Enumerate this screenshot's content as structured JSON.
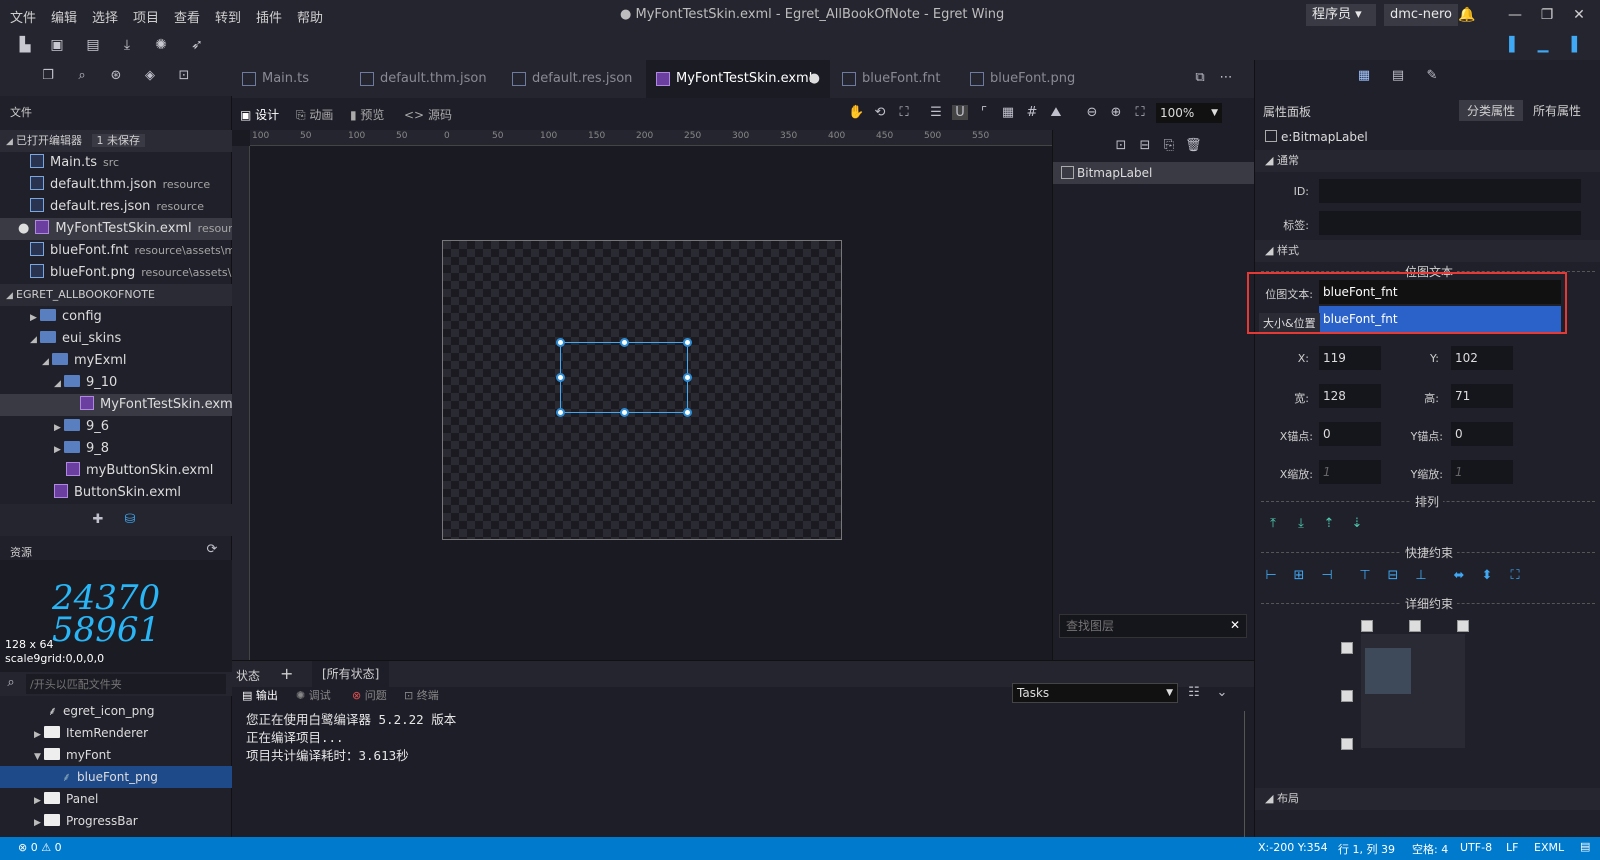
{
  "menu": [
    "文件",
    "编辑",
    "选择",
    "项目",
    "查看",
    "转到",
    "插件",
    "帮助"
  ],
  "window_title": "● MyFontTestSkin.exml - Egret_AllBookOfNote - Egret Wing",
  "role_select": "程序员",
  "user": "dmc-nero",
  "left": {
    "header": "文件",
    "open_editors_label": "已打开编辑器",
    "unsaved_badge": "1 未保存",
    "open_editors": [
      {
        "name": "Main.ts",
        "path": "src"
      },
      {
        "name": "default.thm.json",
        "path": "resource"
      },
      {
        "name": "default.res.json",
        "path": "resource"
      },
      {
        "name": "MyFontTestSkin.exml",
        "path": "resourc..."
      },
      {
        "name": "blueFont.fnt",
        "path": "resource\\assets\\m..."
      },
      {
        "name": "blueFont.png",
        "path": "resource\\assets\\..."
      }
    ],
    "project_label": "EGRET_ALLBOOKOFNOTE",
    "tree": [
      "config",
      "eui_skins",
      "myExml",
      "9_10",
      "MyFontTestSkin.exml",
      "9_6",
      "9_8",
      "myButtonSkin.exml",
      "ButtonSkin.exml"
    ],
    "resources_label": "资源",
    "preview_digits_1": "24370",
    "preview_digits_2": "58961",
    "preview_size": "128 x 64",
    "preview_scale9": "scale9grid:0,0,0,0",
    "search_placeholder": "/开头以匹配文件夹",
    "res_tree": [
      "egret_icon_png",
      "ItemRenderer",
      "myFont",
      "blueFont_png",
      "Panel",
      "ProgressBar"
    ]
  },
  "tabs": [
    "Main.ts",
    "default.thm.json",
    "default.res.json",
    "MyFontTestSkin.exml",
    "blueFont.fnt",
    "blueFont.png"
  ],
  "view_modes": [
    "设计",
    "动画",
    "预览",
    "源码"
  ],
  "zoom": "100%",
  "ruler_ticks": [
    "100",
    "50",
    "100",
    "50",
    "0",
    "50",
    "100",
    "150",
    "200",
    "250",
    "300",
    "350",
    "400",
    "450",
    "500",
    "550"
  ],
  "layers": {
    "item": "BitmapLabel",
    "search_placeholder": "查找图层"
  },
  "bottom": {
    "state_label": "状态",
    "all_states": "[所有状态]",
    "tabs": [
      "输出",
      "调试",
      "问题",
      "终端"
    ],
    "tasks": "Tasks",
    "output": [
      "您正在使用白鹭编译器 5.2.22 版本",
      "正在编译项目...",
      "项目共计编译耗时：3.613秒"
    ]
  },
  "props": {
    "title": "属性面板",
    "category_btn": "分类属性",
    "all_btn": "所有属性",
    "component": "e:BitmapLabel",
    "sect_common": "通常",
    "id_label": "ID:",
    "tag_label": "标签:",
    "sect_style": "样式",
    "bitmap_text_title": "位图文本",
    "bitmap_text_label": "位图文本:",
    "bitmap_text_value": "blueFont_fnt",
    "dropdown_option": "blueFont_fnt",
    "size_pos": "大小&位置",
    "x_label": "X:",
    "x": "119",
    "y_label": "Y:",
    "y": "102",
    "w_label": "宽:",
    "w": "128",
    "h_label": "高:",
    "h": "71",
    "ax_label": "X锚点:",
    "ax": "0",
    "ay_label": "Y锚点:",
    "ay": "0",
    "sx_label": "X缩放:",
    "sx": "1",
    "sy_label": "Y缩放:",
    "sy": "1",
    "arrange": "排列",
    "quick_constraint": "快捷约束",
    "detail_constraint": "详细约束",
    "layout": "布局"
  },
  "status": {
    "errors": "0",
    "warnings": "0",
    "cursor": "X:-200 Y:354",
    "pos": "行 1, 列 39",
    "spaces": "空格: 4",
    "encoding": "UTF-8",
    "eol": "LF",
    "lang": "EXML"
  },
  "colors": {
    "accent": "#007acc",
    "selection": "#3fa9f5",
    "highlight": "#e53935",
    "dropdown": "#2a62c9"
  }
}
